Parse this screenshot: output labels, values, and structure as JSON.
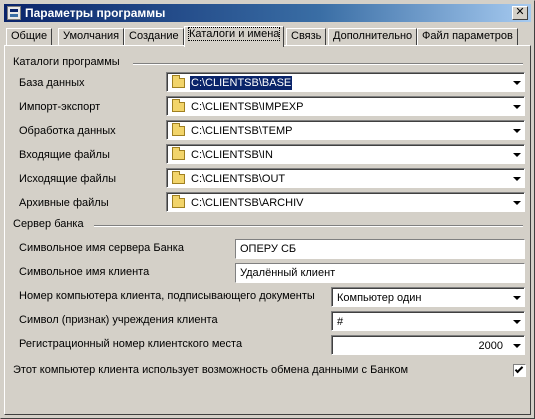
{
  "window": {
    "title": "Параметры программы",
    "close_glyph": "✕"
  },
  "tabs": [
    {
      "label": "Общие"
    },
    {
      "label": "Умолчания"
    },
    {
      "label": "Создание"
    },
    {
      "label": "Каталоги и имена",
      "active": true
    },
    {
      "label": "Связь"
    },
    {
      "label": "Дополнительно"
    },
    {
      "label": "Файл параметров"
    }
  ],
  "catalogs": {
    "heading": "Каталоги программы",
    "rows": [
      {
        "label": "База данных",
        "value": "C:\\CLIENTSB\\BASE",
        "icon": "folder-icon"
      },
      {
        "label": "Импорт-экспорт",
        "value": "C:\\CLIENTSB\\IMPEXP",
        "icon": "folder-icon"
      },
      {
        "label": "Обработка данных",
        "value": "C:\\CLIENTSB\\TEMP",
        "icon": "folder-icon"
      },
      {
        "label": "Входящие файлы",
        "value": "C:\\CLIENTSB\\IN",
        "icon": "folder-icon"
      },
      {
        "label": "Исходящие файлы",
        "value": "C:\\CLIENTSB\\OUT",
        "icon": "folder-icon"
      },
      {
        "label": "Архивные файлы",
        "value": "C:\\CLIENTSB\\ARCHIV",
        "icon": "folder-icon"
      }
    ]
  },
  "bank_server": {
    "heading": "Сервер банка",
    "server_name_label": "Символьное имя сервера Банка",
    "server_name_value": "ОПЕРУ СБ",
    "client_name_label": "Символьное имя клиента",
    "client_name_value": "Удалённый клиент",
    "signer_computer_label": "Номер компьютера клиента, подписывающего документы",
    "signer_computer_value": "Компьютер один",
    "institution_symbol_label": "Символ (признак) учреждения клиента",
    "institution_symbol_value": "#",
    "workstation_number_label": "Регистрационный номер клиентского места",
    "workstation_number_value": "2000",
    "exchange_label": "Этот компьютер клиента использует возможность обмена данными с Банком",
    "exchange_checked": true
  },
  "colors": {
    "titlebar_start": "#0a246a",
    "titlebar_end": "#a6caf0",
    "face": "#d4d0c8",
    "selection": "#0a246a"
  }
}
